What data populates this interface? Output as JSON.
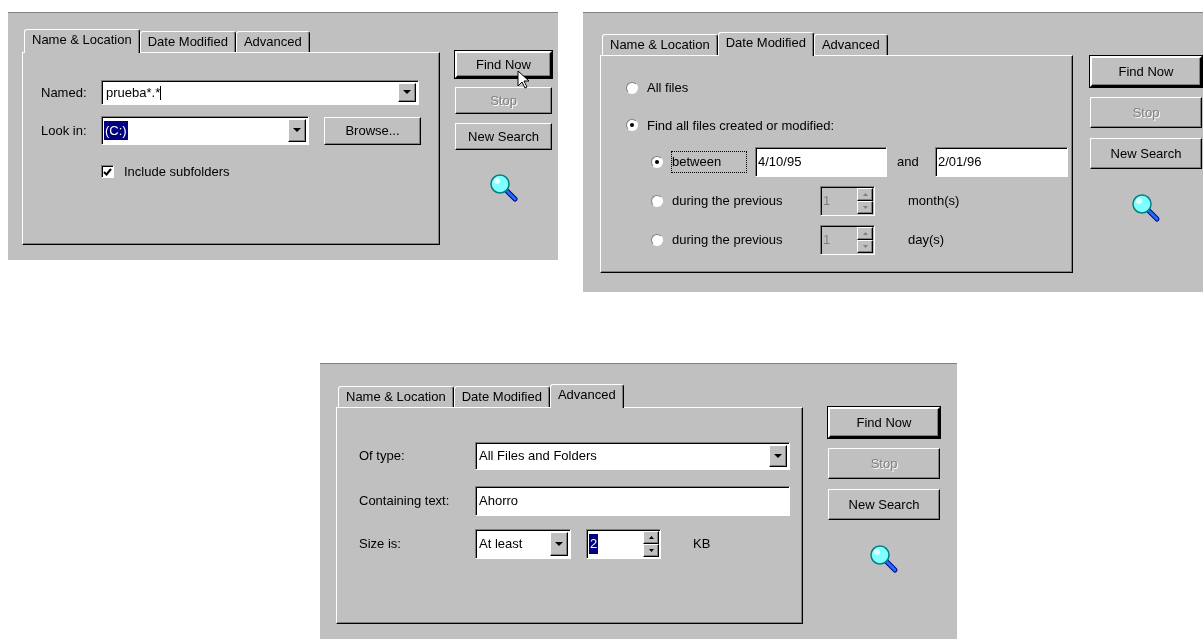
{
  "panels": [
    {
      "kind": "name_location",
      "tabs": [
        {
          "label": "Name & Location",
          "selected": true
        },
        {
          "label": "Date Modified",
          "selected": false
        },
        {
          "label": "Advanced",
          "selected": false
        }
      ],
      "named": {
        "label": "Named:",
        "value": "prueba*.*"
      },
      "look_in": {
        "label": "Look in:",
        "value": "(C:)",
        "highlighted": true
      },
      "browse_button": "Browse...",
      "include_subfolders": {
        "label": "Include subfolders",
        "checked": true
      },
      "buttons": [
        {
          "label": "Find Now",
          "default": true,
          "disabled": false
        },
        {
          "label": "Stop",
          "default": false,
          "disabled": true
        },
        {
          "label": "New Search",
          "default": false,
          "disabled": false
        }
      ]
    },
    {
      "kind": "date_modified",
      "tabs": [
        {
          "label": "Name & Location",
          "selected": false
        },
        {
          "label": "Date Modified",
          "selected": true
        },
        {
          "label": "Advanced",
          "selected": false
        }
      ],
      "date_options": [
        {
          "label": "All files",
          "selected": false
        },
        {
          "label": "Find all files created or modified:",
          "selected": true
        }
      ],
      "ranges": [
        {
          "kind": "between",
          "label": "between",
          "selected": true,
          "from": "4/10/95",
          "joiner": "and",
          "to": "2/01/96"
        },
        {
          "kind": "previous",
          "label": "during the previous",
          "selected": false,
          "value": "1",
          "unit": "month(s)"
        },
        {
          "kind": "previous",
          "label": "during the previous",
          "selected": false,
          "value": "1",
          "unit": "day(s)"
        }
      ],
      "buttons": [
        {
          "label": "Find Now",
          "default": true,
          "disabled": false
        },
        {
          "label": "Stop",
          "default": false,
          "disabled": true
        },
        {
          "label": "New Search",
          "default": false,
          "disabled": false
        }
      ]
    },
    {
      "kind": "advanced",
      "tabs": [
        {
          "label": "Name & Location",
          "selected": false
        },
        {
          "label": "Date Modified",
          "selected": false
        },
        {
          "label": "Advanced",
          "selected": true
        }
      ],
      "of_type": {
        "label": "Of type:",
        "value": "All Files and Folders"
      },
      "containing_text": {
        "label": "Containing text:",
        "value": "Ahorro"
      },
      "size": {
        "label": "Size is:",
        "mode": "At least",
        "value": "2",
        "highlighted": true,
        "unit": "KB"
      },
      "buttons": [
        {
          "label": "Find Now",
          "default": true,
          "disabled": false
        },
        {
          "label": "Stop",
          "default": false,
          "disabled": true
        },
        {
          "label": "New Search",
          "default": false,
          "disabled": false
        }
      ]
    }
  ]
}
